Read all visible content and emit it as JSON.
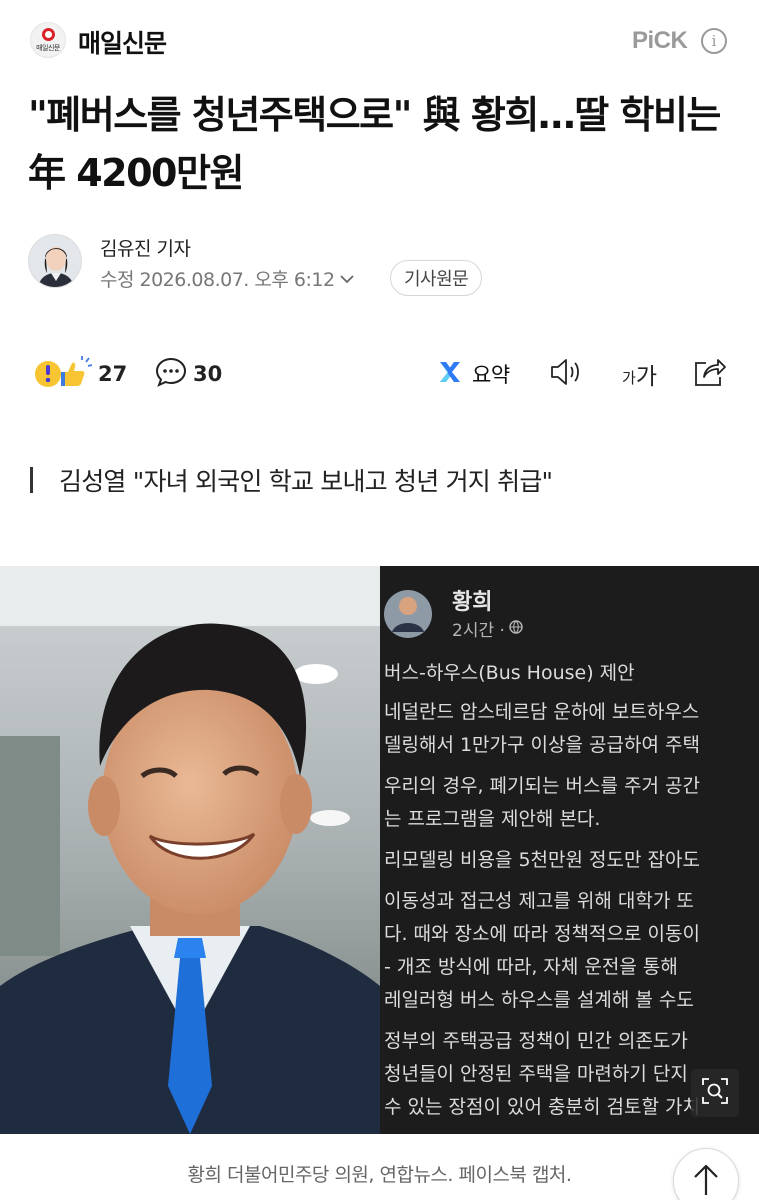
{
  "header": {
    "press_name": "매일신문",
    "press_logo_mini": "매일신문",
    "pick_label": "PiCK",
    "info_glyph": "i"
  },
  "article": {
    "headline": "\"폐버스를 청년주택으로\" 與 황희…딸 학비는 年 4200만원",
    "reporter": "김유진 기자",
    "date_label": "수정 2026.08.07. 오후 6:12",
    "original_button": "기사원문",
    "subheading": "김성열 \"자녀 외국인 학교 보내고 청년 거지 취급\""
  },
  "toolbar": {
    "reaction_count": "27",
    "comment_count": "30",
    "summary_label": "요약",
    "font_size_label_small": "가",
    "font_size_label_large": "가"
  },
  "photo": {
    "caption": "황희 더불어민주당 의원, 연합뉴스. 페이스북 캡처.",
    "post": {
      "author": "황희",
      "time": "2시간 ·",
      "lines": [
        "버스-하우스(Bus House) 제안",
        "네덜란드 암스테르담 운하에 보트하우스",
        "델링해서 1만가구 이상을 공급하여 주택",
        "우리의 경우, 폐기되는 버스를 주거 공간",
        "는 프로그램을 제안해 본다.",
        "리모델링 비용을 5천만원 정도만 잡아도",
        "이동성과 접근성 제고를 위해 대학가 또",
        "다. 때와 장소에 따라 정책적으로 이동이",
        "- 개조 방식에 따라, 자체 운전을 통해",
        "레일러형 버스 하우스를 설계해 볼 수도",
        "정부의 주택공급 정책이 민간 의존도가",
        "청년들이 안정된 주택을 마련하기 단지",
        "수 있는 장점이 있어 충분히 검토할 가치"
      ]
    }
  },
  "colors": {
    "brand_red": "#d8232a",
    "summary_blue": "#2f7bf5",
    "reaction_yellow": "#f6c531",
    "tie_blue": "#1e6fd8"
  }
}
